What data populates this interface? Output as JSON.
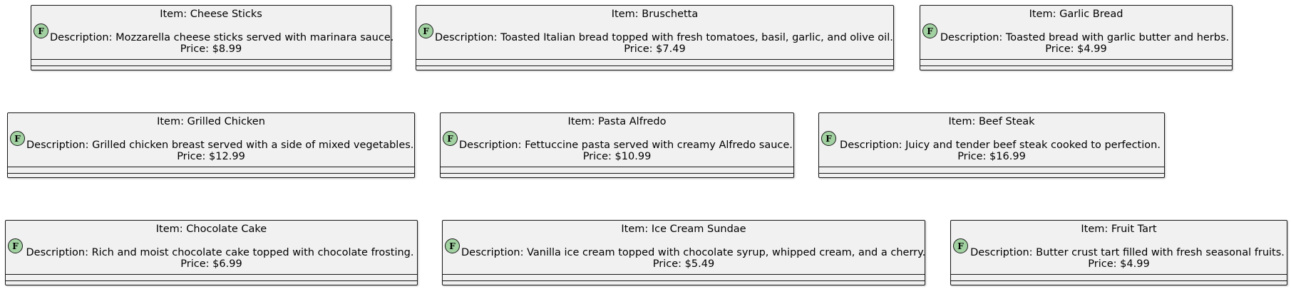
{
  "icon": {
    "name": "f-class-icon",
    "letter": "F",
    "color": "#a2d2a2"
  },
  "items": [
    {
      "title": "Item: Cheese Sticks",
      "description": "Description: Mozzarella cheese sticks served with marinara sauce.",
      "price": "Price: $8.99"
    },
    {
      "title": "Item: Bruschetta",
      "description": "Description: Toasted Italian bread topped with fresh tomatoes, basil, garlic, and olive oil.",
      "price": "Price: $7.49"
    },
    {
      "title": "Item: Garlic Bread",
      "description": "Description: Toasted bread with garlic butter and herbs.",
      "price": "Price: $4.99"
    },
    {
      "title": "Item: Grilled Chicken",
      "description": "Description: Grilled chicken breast served with a side of mixed vegetables.",
      "price": "Price: $12.99"
    },
    {
      "title": "Item: Pasta Alfredo",
      "description": "Description: Fettuccine pasta served with creamy Alfredo sauce.",
      "price": "Price: $10.99"
    },
    {
      "title": "Item: Beef Steak",
      "description": "Description: Juicy and tender beef steak cooked to perfection.",
      "price": "Price: $16.99"
    },
    {
      "title": "Item: Chocolate Cake",
      "description": "Description: Rich and moist chocolate cake topped with chocolate frosting.",
      "price": "Price: $6.99"
    },
    {
      "title": "Item: Ice Cream Sundae",
      "description": "Description: Vanilla ice cream topped with chocolate syrup, whipped cream, and a cherry.",
      "price": "Price: $5.49"
    },
    {
      "title": "Item: Fruit Tart",
      "description": "Description: Butter crust tart filled with fresh seasonal fruits.",
      "price": "Price: $4.99"
    }
  ]
}
